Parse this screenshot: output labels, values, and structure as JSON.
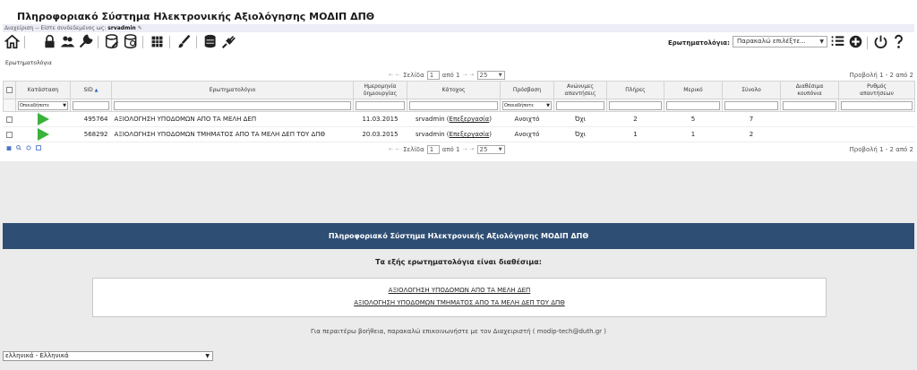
{
  "app": {
    "title": "Πληροφοριακό Σύστημα Ηλεκτρονικής Αξιολόγησης ΜΟΔΙΠ ΔΠΘ"
  },
  "userbar": {
    "admin_link": "Διαχείριση",
    "sep": " -- ",
    "logged_in_text": "Είστε συνδεδεμένος ως:",
    "username": "srvadmin"
  },
  "toolbar": {
    "icons": [
      "home-icon",
      "lock-icon",
      "users-icon",
      "wrench-icon",
      "database-edit-icon",
      "database-search-icon",
      "grid-icon",
      "brush-icon",
      "database-plug-icon",
      "plug-icon"
    ],
    "questionnaires_label": "Ερωτηματολόγια:",
    "questionnaires_select": "Παρακαλώ επιλέξτε...",
    "right_icons": [
      "list-icon",
      "add-circle-icon",
      "power-icon",
      "help-icon"
    ]
  },
  "section_label": "Ερωτηματολόγια",
  "pager": {
    "page_label": "Σελίδα",
    "page_value": "1",
    "of_label": "από 1",
    "page_size": "25",
    "view_info": "Προβολή 1 - 2 από 2"
  },
  "table": {
    "headers": {
      "status": "Κατάσταση",
      "sid": "SID",
      "questionnaire": "Ερωτηματολόγιο",
      "created_line1": "Ημερομηνία",
      "created_line2": "δημιουργίας",
      "owner": "Κάτοχος",
      "access": "Πρόσβαση",
      "anonymous_line1": "Ανώνυμες",
      "anonymous_line2": "απαντήσεις",
      "full": "Πλήρες",
      "partial": "Μερικό",
      "total": "Σύνολο",
      "coupons_line1": "Διαθέσιμα",
      "coupons_line2": "κουπόνια",
      "rate_line1": "Ρυθμός",
      "rate_line2": "απαντήσεων"
    },
    "filter_any": "Οποιαδήποτε",
    "rows": [
      {
        "sid": "495764",
        "title": "ΑΞΙΟΛΟΓΗΣΗ ΥΠΟΔΟΜΩΝ ΑΠΟ ΤΑ ΜΕΛΗ ΔΕΠ",
        "created": "11.03.2015",
        "owner": "srvadmin",
        "edit": "Επεξεργασία",
        "access": "Ανοιχτό",
        "anonymous": "Όχι",
        "full": "2",
        "partial": "5",
        "total": "7"
      },
      {
        "sid": "568292",
        "title": "ΑΞΙΟΛΟΓΗΣΗ ΥΠΟΔΟΜΩΝ ΤΜΗΜΑΤΟΣ ΑΠΟ ΤΑ ΜΕΛΗ ΔΕΠ ΤΟΥ ΔΠΘ",
        "created": "20.03.2015",
        "owner": "srvadmin",
        "edit": "Επεξεργασία",
        "access": "Ανοιχτό",
        "anonymous": "Όχι",
        "full": "1",
        "partial": "1",
        "total": "2"
      }
    ]
  },
  "public": {
    "banner": "Πληροφοριακό Σύστημα Ηλεκτρονικής Αξιολόγησης ΜΟΔΙΠ ΔΠΘ",
    "available": "Τα εξής ερωτηματολόγια είναι διαθέσιμα:",
    "links": [
      "ΑΞΙΟΛΟΓΗΣΗ ΥΠΟΔΟΜΩΝ ΑΠΟ ΤΑ ΜΕΛΗ ΔΕΠ",
      "ΑΞΙΟΛΟΓΗΣΗ ΥΠΟΔΟΜΩΝ ΤΜΗΜΑΤΟΣ ΑΠΟ ΤΑ ΜΕΛΗ ΔΕΠ ΤΟΥ ΔΠΘ"
    ],
    "help": "Για περαιτέρω βοήθεια, παρακαλώ επικοινωνήστε με τον Διαχειριστή ( modip-tech@duth.gr )",
    "language": "ελληνικά - Ελληνικά"
  },
  "colors": {
    "banner_bg": "#2f4e74",
    "play_green": "#3bb23b",
    "userbar_bg": "#ededf7"
  }
}
